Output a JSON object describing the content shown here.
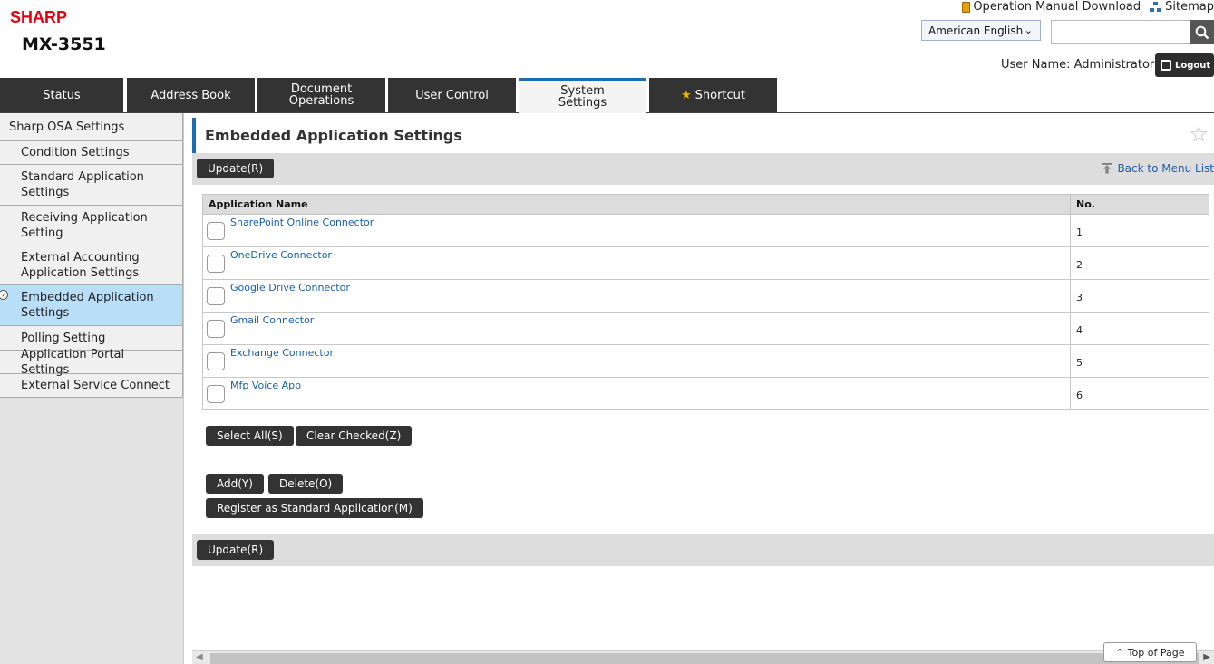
{
  "header": {
    "brand": "SHARP",
    "model": "MX-3551",
    "links": [
      {
        "label": "Operation Manual Download",
        "icon": "manual-icon"
      },
      {
        "label": "Sitemap",
        "icon": "sitemap-icon"
      }
    ],
    "language": "American English",
    "search_value": "",
    "user_label": "User Name: Administrator",
    "logout_label": "Logout"
  },
  "tabs": [
    {
      "label": "Status"
    },
    {
      "label": "Address Book"
    },
    {
      "label": "Document\nOperations"
    },
    {
      "label": "User Control"
    },
    {
      "label": "System\nSettings",
      "active": true
    },
    {
      "label": "Shortcut",
      "icon": "star-icon"
    }
  ],
  "sidebar": {
    "items": [
      {
        "label": "Sharp OSA Settings",
        "level": "top"
      },
      {
        "label": "Condition Settings"
      },
      {
        "label": "Standard Application Settings"
      },
      {
        "label": "Receiving Application Setting"
      },
      {
        "label": "External Accounting Application Settings"
      },
      {
        "label": "Embedded Application Settings",
        "active": true
      },
      {
        "label": "Polling Setting"
      },
      {
        "label": "Application Portal Settings"
      },
      {
        "label": "External Service Connect"
      }
    ]
  },
  "main": {
    "title": "Embedded Application Settings",
    "update_label": "Update(R)",
    "back_label": "Back to Menu List",
    "table": {
      "columns": [
        "Application Name",
        "No."
      ],
      "rows": [
        {
          "name": "SharePoint Online Connector",
          "no": "1"
        },
        {
          "name": "OneDrive Connector",
          "no": "2"
        },
        {
          "name": "Google Drive Connector",
          "no": "3"
        },
        {
          "name": "Gmail Connector",
          "no": "4"
        },
        {
          "name": "Exchange Connector",
          "no": "5"
        },
        {
          "name": "Mfp Voice App",
          "no": "6"
        }
      ]
    },
    "select_all_label": "Select All(S)",
    "clear_checked_label": "Clear Checked(Z)",
    "add_label": "Add(Y)",
    "delete_label": "Delete(O)",
    "register_label": "Register as Standard Application(M)",
    "top_of_page_label": "Top of Page"
  },
  "colors": {
    "brand": "#e60012",
    "accent": "#1a6fb4",
    "active_sidebar": "#b9def7",
    "tab_dark": "#333333"
  }
}
